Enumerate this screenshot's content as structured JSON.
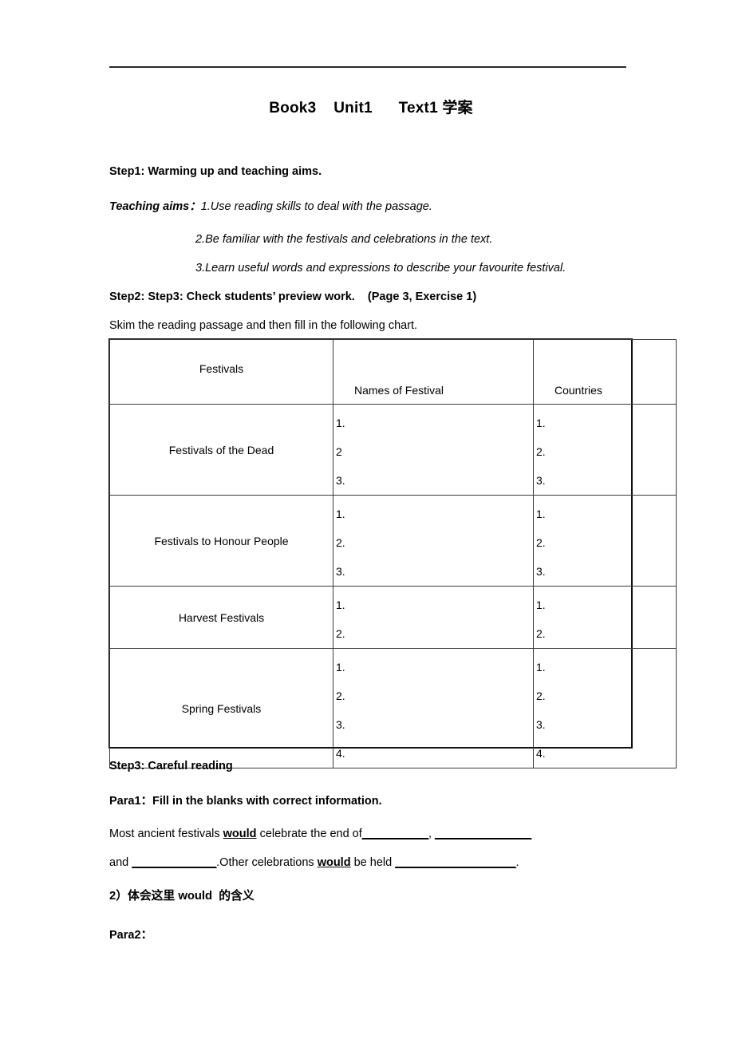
{
  "document": {
    "title": "Book3    Unit1      Text1 学案"
  },
  "sections": {
    "step1_heading": "Step1: Warming up and teaching aims.",
    "teaching_aims_label": "Teaching aims",
    "teaching_aims_colon": "：",
    "aim_1": "1.Use reading skills to deal with the passage.",
    "aim_2": "2.Be familiar with the festivals and celebrations in the text.",
    "aim_3": "3.Learn useful words and expressions to describe your favourite festival.",
    "step2_heading": "Step2: Step3: Check students’ preview work.    (Page 3, Exercise 1)",
    "skim_instruction": "Skim the reading passage and then fill in the following chart.",
    "step3_heading": "Step3: Careful reading",
    "para1_heading": "Para1：Fill in the blanks with correct information.",
    "fill_line1_part1": "Most ancient festivals ",
    "fill_line1_would": "would",
    "fill_line1_part2": " celebrate the end of",
    "fill_line1_blank1": "___________",
    "fill_line1_comma": ", ",
    "fill_line1_blank2": "________________",
    "fill_line2_part1": "and ",
    "fill_line2_blank1": "______________",
    "fill_line2_part2": ".Other celebrations ",
    "fill_line2_would": "would",
    "fill_line2_part3": " be held ",
    "fill_line2_blank2": "____________________",
    "fill_line2_period": ".",
    "item2_heading": "2）体会这里 would  的含义",
    "para2_heading": "Para2："
  },
  "chart_data": {
    "type": "table",
    "title": "Skim the reading passage and then fill in the following chart.",
    "columns": [
      "Festivals",
      "Names of Festival",
      "Countries"
    ],
    "rows": [
      {
        "festival_type": "Festivals of the Dead",
        "names": [
          "1.",
          "2",
          "3."
        ],
        "countries": [
          "1.",
          "2.",
          "3."
        ]
      },
      {
        "festival_type": "Festivals to Honour People",
        "names": [
          "1.",
          "2.",
          "3."
        ],
        "countries": [
          "1.",
          "2.",
          "3."
        ]
      },
      {
        "festival_type": "Harvest Festivals",
        "names": [
          "1.",
          "2."
        ],
        "countries": [
          "1.",
          "2."
        ]
      },
      {
        "festival_type": "Spring Festivals",
        "names": [
          "1.",
          "2.",
          "3.",
          "4."
        ],
        "countries": [
          "1.",
          "2.",
          "3.",
          "4."
        ]
      }
    ]
  }
}
